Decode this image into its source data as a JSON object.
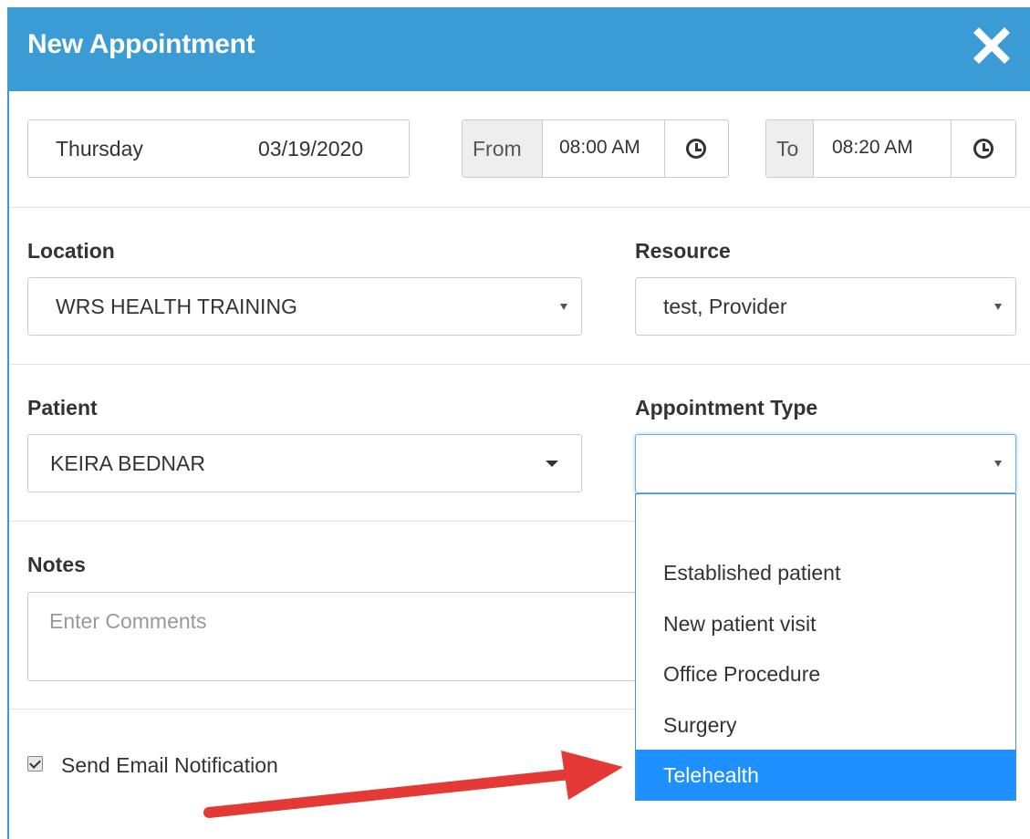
{
  "dialog": {
    "title": "New Appointment"
  },
  "schedule": {
    "day": "Thursday",
    "date": "03/19/2020",
    "from_label": "From",
    "from_time": "08:00 AM",
    "to_label": "To",
    "to_time": "08:20 AM"
  },
  "location": {
    "label": "Location",
    "value": "WRS HEALTH TRAINING"
  },
  "resource": {
    "label": "Resource",
    "value": "test, Provider"
  },
  "patient": {
    "label": "Patient",
    "value": "KEIRA BEDNAR"
  },
  "appointment_type": {
    "label": "Appointment Type",
    "value": "",
    "options": [
      "",
      "Established patient",
      "New patient visit",
      "Office Procedure",
      "Surgery",
      "Telehealth"
    ],
    "highlighted": "Telehealth"
  },
  "notes": {
    "label": "Notes",
    "placeholder": "Enter Comments"
  },
  "notification": {
    "label": "Send Email Notification",
    "checked": true
  },
  "colors": {
    "header": "#3a9bd5",
    "highlight": "#1e90ff",
    "arrow": "#e53935"
  }
}
